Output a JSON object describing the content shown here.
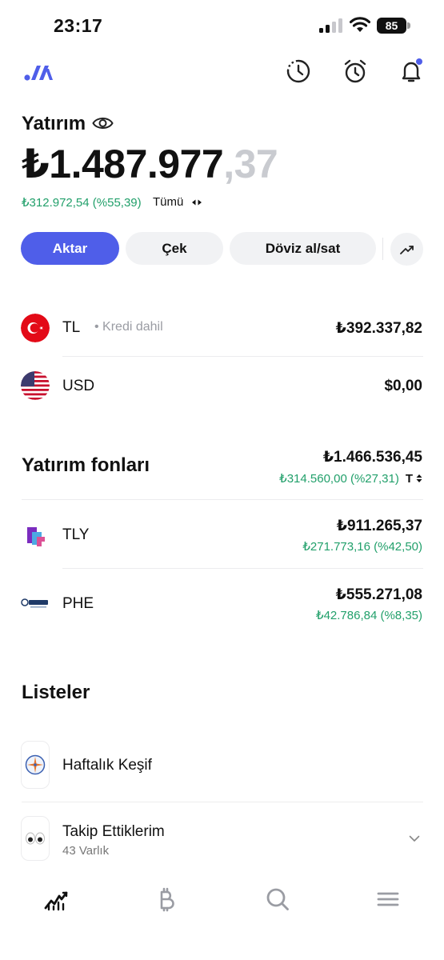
{
  "status_bar": {
    "time": "23:17",
    "battery": "85"
  },
  "header": {
    "logo": "brand-logo-icon",
    "icons": [
      "history-icon",
      "alarm-icon",
      "bell-icon"
    ],
    "notification_dot_color": "#4f5ee9"
  },
  "portfolio": {
    "title": "Yatırım",
    "balance_main": "₺1.487.977",
    "balance_decimal": ",37",
    "change": "₺312.972,54 (%55,39)",
    "period": "Tümü"
  },
  "actions": {
    "transfer": "Aktar",
    "withdraw": "Çek",
    "fx": "Döviz al/sat"
  },
  "cash": [
    {
      "code": "TL",
      "note": "Kredi dahil",
      "amount": "₺392.337,82"
    },
    {
      "code": "USD",
      "amount": "$0,00"
    }
  ],
  "funds": {
    "title": "Yatırım fonları",
    "total": "₺1.466.536,45",
    "change": "₺314.560,00 (%27,31)",
    "sort": "T",
    "items": [
      {
        "code": "TLY",
        "amount": "₺911.265,37",
        "change": "₺271.773,16 (%42,50)"
      },
      {
        "code": "PHE",
        "amount": "₺555.271,08",
        "change": "₺42.786,84 (%8,35)"
      }
    ]
  },
  "lists": {
    "title": "Listeler",
    "items": [
      {
        "name": "Haftalık Keşif"
      },
      {
        "name": "Takip Ettiklerim",
        "sub": "43 Varlık"
      }
    ]
  },
  "tab_bar": [
    "portfolio-chart-icon",
    "bitcoin-icon",
    "search-icon",
    "menu-icon"
  ],
  "colors": {
    "accent": "#4f5ee9",
    "positive": "#22a06b"
  }
}
